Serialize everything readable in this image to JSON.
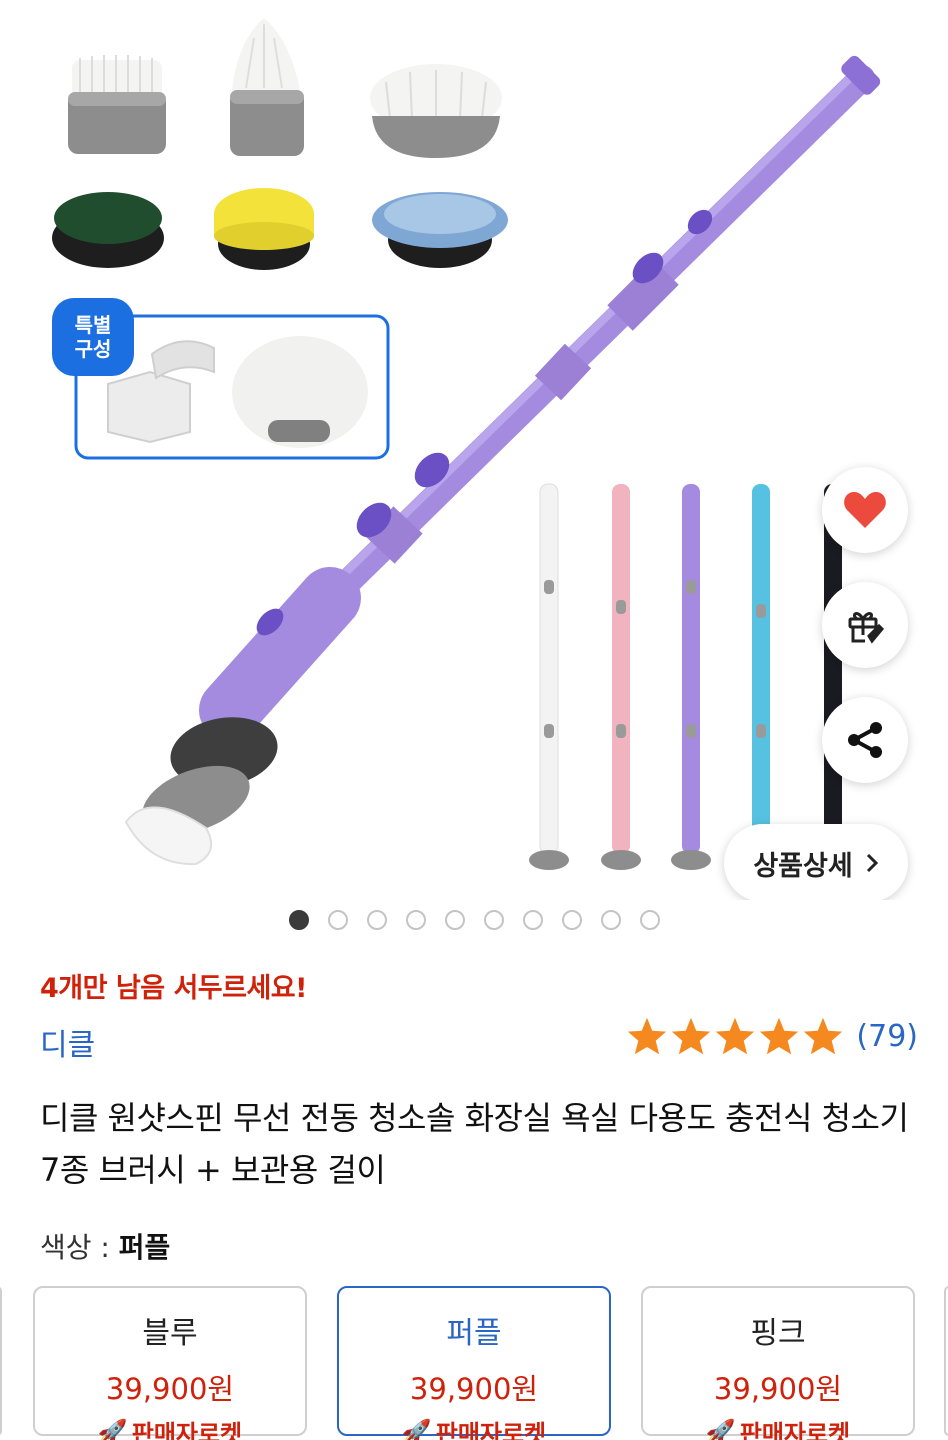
{
  "gallery": {
    "badge_special": "특별\n구성",
    "detail_button": "상품상세",
    "page_count": 10,
    "active_page": 1
  },
  "stock_notice": "4개만 남음 서두르세요!",
  "brand": "디클",
  "rating": {
    "stars": 5,
    "count": "(79)"
  },
  "product_title": "디클 원샷스핀 무선 전동 청소솔 화장실 욕실 다용도 충전식 청소기 7종 브러시 + 보관용 걸이",
  "color": {
    "label": "색상 :",
    "value": "퍼플"
  },
  "options": [
    {
      "name": "블루",
      "price": "39,900원",
      "tag": "판매자로켓"
    },
    {
      "name": "퍼플",
      "price": "39,900원",
      "tag": "판매자로켓",
      "selected": true
    },
    {
      "name": "핑크",
      "price": "39,900원",
      "tag": "판매자로켓"
    }
  ],
  "colors": {
    "accent_blue": "#2a66c4",
    "alert_red": "#d0210b",
    "star_orange": "#f5891f",
    "handle_purple": "#a58be0"
  }
}
